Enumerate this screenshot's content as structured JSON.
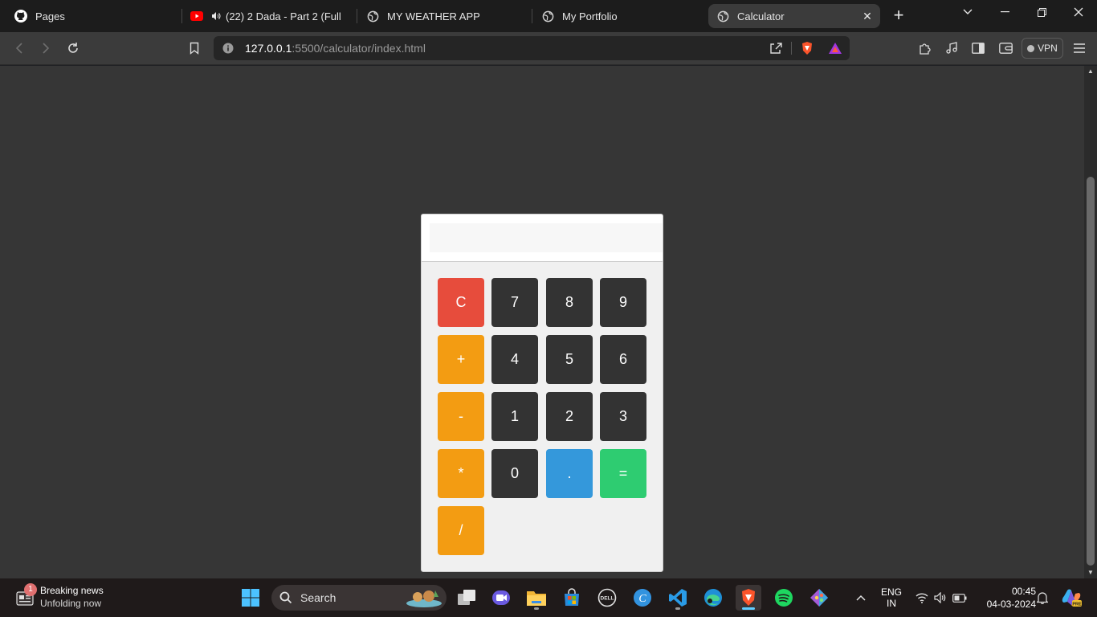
{
  "browser": {
    "tabs": [
      {
        "title": "Pages",
        "icon": "github-icon"
      },
      {
        "title": "(22) 2 Dada - Part 2 (Full Vide",
        "icon": "youtube-icon",
        "audio": true
      },
      {
        "title": "MY WEATHER APP",
        "icon": "globe-icon"
      },
      {
        "title": "My Portfolio",
        "icon": "globe-icon"
      },
      {
        "title": "Calculator",
        "icon": "globe-icon",
        "active": true
      }
    ],
    "url_host": "127.0.0.1",
    "url_rest": ":5500/calculator/index.html",
    "vpn_label": "VPN"
  },
  "calculator": {
    "display_value": "",
    "keys": [
      {
        "label": "C",
        "color": "#e74c3c"
      },
      {
        "label": "7",
        "color": "#333333"
      },
      {
        "label": "8",
        "color": "#333333"
      },
      {
        "label": "9",
        "color": "#333333"
      },
      {
        "label": "+",
        "color": "#f39c12"
      },
      {
        "label": "4",
        "color": "#333333"
      },
      {
        "label": "5",
        "color": "#333333"
      },
      {
        "label": "6",
        "color": "#333333"
      },
      {
        "label": "-",
        "color": "#f39c12"
      },
      {
        "label": "1",
        "color": "#333333"
      },
      {
        "label": "2",
        "color": "#333333"
      },
      {
        "label": "3",
        "color": "#333333"
      },
      {
        "label": "*",
        "color": "#f39c12"
      },
      {
        "label": "0",
        "color": "#333333"
      },
      {
        "label": ".",
        "color": "#3498db"
      },
      {
        "label": "=",
        "color": "#2ecc71"
      },
      {
        "label": "/",
        "color": "#f39c12"
      }
    ]
  },
  "taskbar": {
    "news_title": "Breaking news",
    "news_subtitle": "Unfolding now",
    "news_badge": "1",
    "search_label": "Search",
    "apps": [
      "windows-start-icon",
      "task-view-icon",
      "meet-icon",
      "file-explorer-icon",
      "ms-store-icon",
      "dell-icon",
      "canva-icon",
      "vscode-icon",
      "edge-icon",
      "brave-icon",
      "spotify-icon",
      "git-icon"
    ],
    "lang_line1": "ENG",
    "lang_line2": "IN",
    "time": "00:45",
    "date": "04-03-2024"
  }
}
